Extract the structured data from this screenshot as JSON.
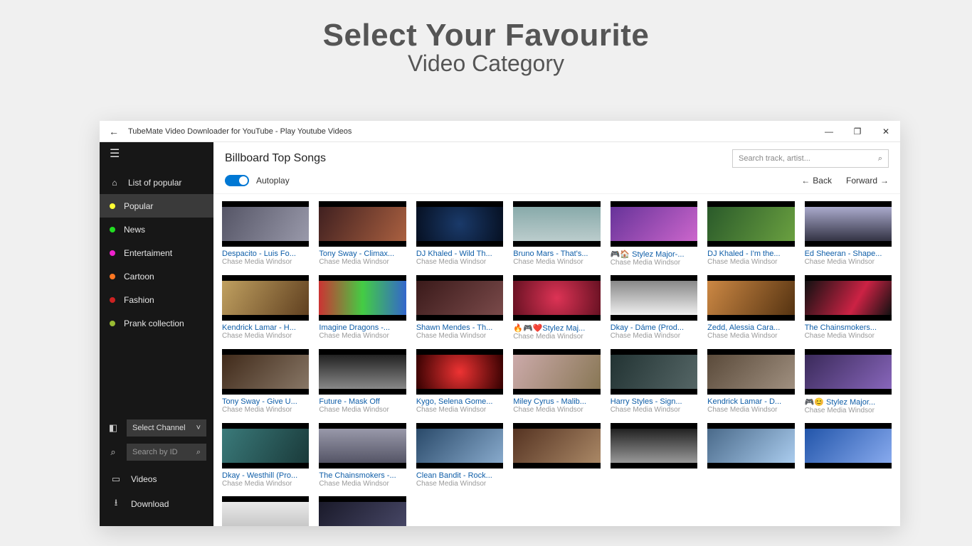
{
  "promo": {
    "title": "Select Your Favourite",
    "subtitle": "Video Category"
  },
  "window": {
    "title": "TubeMate Video Downloader for YouTube - Play Youtube Videos",
    "minimize": "—",
    "maximize": "❐",
    "close": "✕",
    "back_arrow": "←"
  },
  "sidebar": {
    "home_label": "List of popular",
    "items": [
      {
        "label": "Popular",
        "color": "#ffff33",
        "active": true
      },
      {
        "label": "News",
        "color": "#22dd22"
      },
      {
        "label": "Entertaiment",
        "color": "#ee22cc"
      },
      {
        "label": "Cartoon",
        "color": "#ff7722"
      },
      {
        "label": "Fashion",
        "color": "#cc2222"
      },
      {
        "label": "Prank collection",
        "color": "#99bb33"
      }
    ],
    "select_channel": "Select Channel",
    "search_placeholder": "Search by ID",
    "videos_label": "Videos",
    "download_label": "Download"
  },
  "main": {
    "heading": "Billboard Top Songs",
    "search_placeholder": "Search track, artist...",
    "autoplay_label": "Autoplay",
    "back_label": "Back",
    "forward_label": "Forward"
  },
  "channel": "Chase Media Windsor",
  "videos": [
    {
      "title": "Despacito - Luis Fo...",
      "art": 0
    },
    {
      "title": "Tony Sway - Climax...",
      "art": 1
    },
    {
      "title": "DJ Khaled - Wild Th...",
      "art": 2
    },
    {
      "title": "Bruno Mars - That's...",
      "art": 3
    },
    {
      "title": "🎮🏠 Stylez Major-...",
      "art": 4
    },
    {
      "title": "DJ Khaled - I'm the...",
      "art": 5
    },
    {
      "title": "Ed Sheeran - Shape...",
      "art": 6
    },
    {
      "title": "Kendrick Lamar - H...",
      "art": 7
    },
    {
      "title": "Imagine Dragons -...",
      "art": 8
    },
    {
      "title": "Shawn Mendes - Th...",
      "art": 9
    },
    {
      "title": "🔥🎮❤️Stylez Maj...",
      "art": 10
    },
    {
      "title": "Dkay - Dáme (Prod...",
      "art": 11
    },
    {
      "title": "Zedd, Alessia Cara...",
      "art": 12
    },
    {
      "title": "The Chainsmokers...",
      "art": 13
    },
    {
      "title": "Tony Sway - Give U...",
      "art": 14
    },
    {
      "title": "Future - Mask Off",
      "art": 15
    },
    {
      "title": "Kygo, Selena Gome...",
      "art": 16
    },
    {
      "title": "Miley Cyrus - Malib...",
      "art": 17
    },
    {
      "title": "Harry Styles - Sign...",
      "art": 18
    },
    {
      "title": "Kendrick Lamar - D...",
      "art": 19
    },
    {
      "title": "🎮😊 Stylez Major...",
      "art": 20
    },
    {
      "title": "Dkay - Westhill (Pro...",
      "art": 21
    },
    {
      "title": "The Chainsmokers -...",
      "art": 22
    },
    {
      "title": "Clean Bandit - Rock...",
      "art": 23
    },
    {
      "title": "",
      "art": 24
    },
    {
      "title": "",
      "art": 25
    },
    {
      "title": "",
      "art": 26
    },
    {
      "title": "",
      "art": 27
    },
    {
      "title": "",
      "art": 28
    },
    {
      "title": "",
      "art": 29
    }
  ]
}
